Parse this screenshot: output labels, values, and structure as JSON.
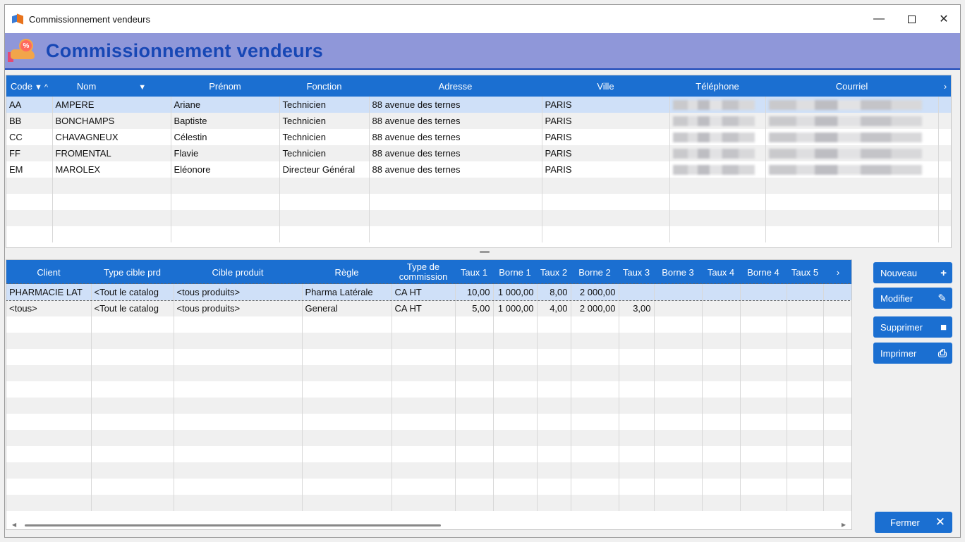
{
  "window": {
    "title": "Commissionnement vendeurs",
    "min": "—",
    "close": "✕"
  },
  "header": {
    "title": "Commissionnement vendeurs",
    "coin_symbol": "%"
  },
  "sellers": {
    "columns": [
      "Code",
      "Nom",
      "Prénom",
      "Fonction",
      "Adresse",
      "Ville",
      "Téléphone",
      "Courriel"
    ],
    "rows": [
      [
        "AA",
        "AMPERE",
        "Ariane",
        "Technicien",
        "88 avenue des ternes",
        "PARIS"
      ],
      [
        "BB",
        "BONCHAMPS",
        "Baptiste",
        "Technicien",
        "88 avenue des ternes",
        "PARIS"
      ],
      [
        "CC",
        "CHAVAGNEUX",
        "Célestin",
        "Technicien",
        "88 avenue des ternes",
        "PARIS"
      ],
      [
        "FF",
        "FROMENTAL",
        "Flavie",
        "Technicien",
        "88 avenue des ternes",
        "PARIS"
      ],
      [
        "EM",
        "MAROLEX",
        "Eléonore",
        "Directeur Général",
        "88 avenue des ternes",
        "PARIS"
      ]
    ]
  },
  "rules": {
    "columns": [
      "Client",
      "Type cible prd",
      "Cible produit",
      "Règle",
      "Type de commission",
      "Taux 1",
      "Borne 1",
      "Taux 2",
      "Borne 2",
      "Taux 3",
      "Borne 3",
      "Taux 4",
      "Borne 4",
      "Taux 5"
    ],
    "rows": [
      [
        "PHARMACIE LAT",
        "<Tout le catalog",
        "<tous produits>",
        "Pharma Latérale",
        "CA HT",
        "10,00",
        "1 000,00",
        "8,00",
        "2 000,00",
        "",
        "",
        "",
        "",
        ""
      ],
      [
        "<tous>",
        "<Tout le catalog",
        "<tous produits>",
        "General",
        "CA HT",
        "5,00",
        "1 000,00",
        "4,00",
        "2 000,00",
        "3,00",
        "",
        "",
        "",
        ""
      ]
    ]
  },
  "buttons": {
    "nouveau": "Nouveau",
    "modifier": "Modifier",
    "supprimer": "Supprimer",
    "imprimer": "Imprimer",
    "fermer": "Fermer"
  }
}
